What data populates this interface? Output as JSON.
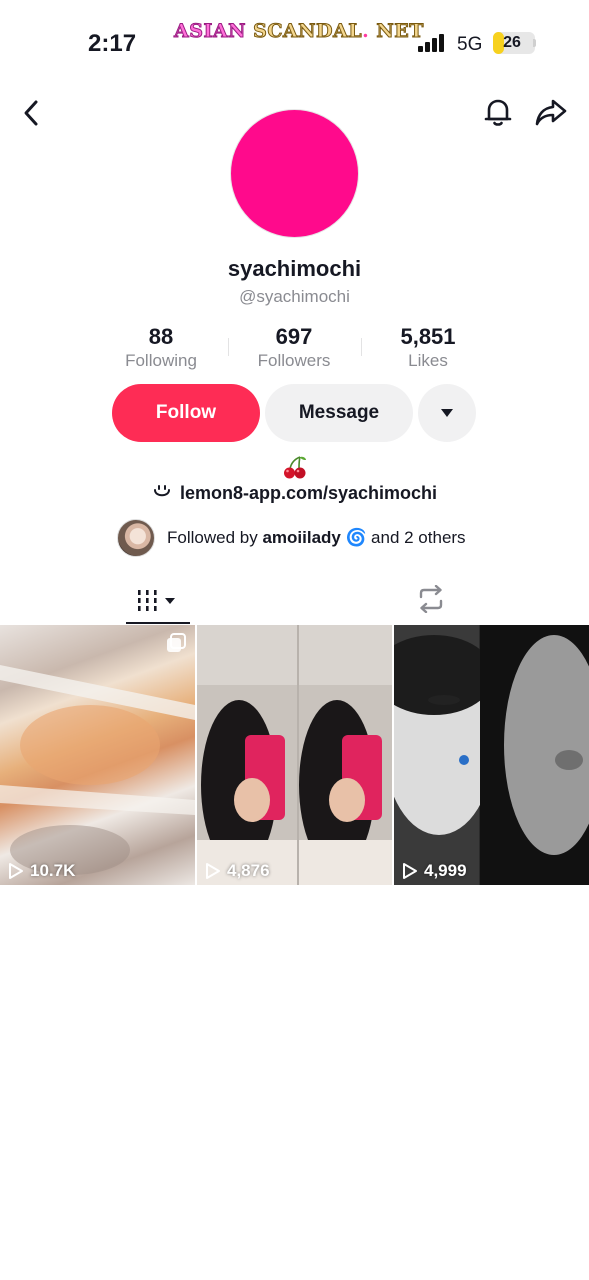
{
  "status_bar": {
    "time": "2:17",
    "watermark_part1": "ASIAN",
    "watermark_part2": "SCANDAL",
    "watermark_dot": ".",
    "watermark_part3": "NET",
    "network": "5G",
    "battery": "26",
    "battery_level_percent": 26
  },
  "nav": {
    "back_icon": "chevron-left-icon",
    "bell_icon": "bell-icon",
    "share_icon": "share-arrow-icon"
  },
  "profile": {
    "avatar_color": "#ff0a8c",
    "display_name": "syachimochi",
    "handle": "@syachimochi",
    "stats": [
      {
        "value": "88",
        "label": "Following"
      },
      {
        "value": "697",
        "label": "Followers"
      },
      {
        "value": "5,851",
        "label": "Likes"
      }
    ],
    "buttons": {
      "follow": "Follow",
      "message": "Message",
      "more_icon": "caret-down-icon"
    },
    "bio_emoji_icon": "cherry-icon",
    "link_icon": "smile-link-icon",
    "link": "lemon8-app.com/syachimochi",
    "followed_by": {
      "prefix": "Followed by",
      "user": "amoiilady",
      "user_emoji": "🌀",
      "suffix": "and 2 others"
    }
  },
  "tabs": {
    "videos_icon": "grid-columns-icon",
    "reposts_icon": "repost-icon"
  },
  "videos": [
    {
      "views": "10.7K",
      "multi_image": true
    },
    {
      "views": "4,876",
      "multi_image": false
    },
    {
      "views": "4,999",
      "multi_image": false
    }
  ],
  "colors": {
    "follow_button": "#fe2c55",
    "secondary_button": "#f1f1f2",
    "muted_text": "#8a8b91"
  }
}
